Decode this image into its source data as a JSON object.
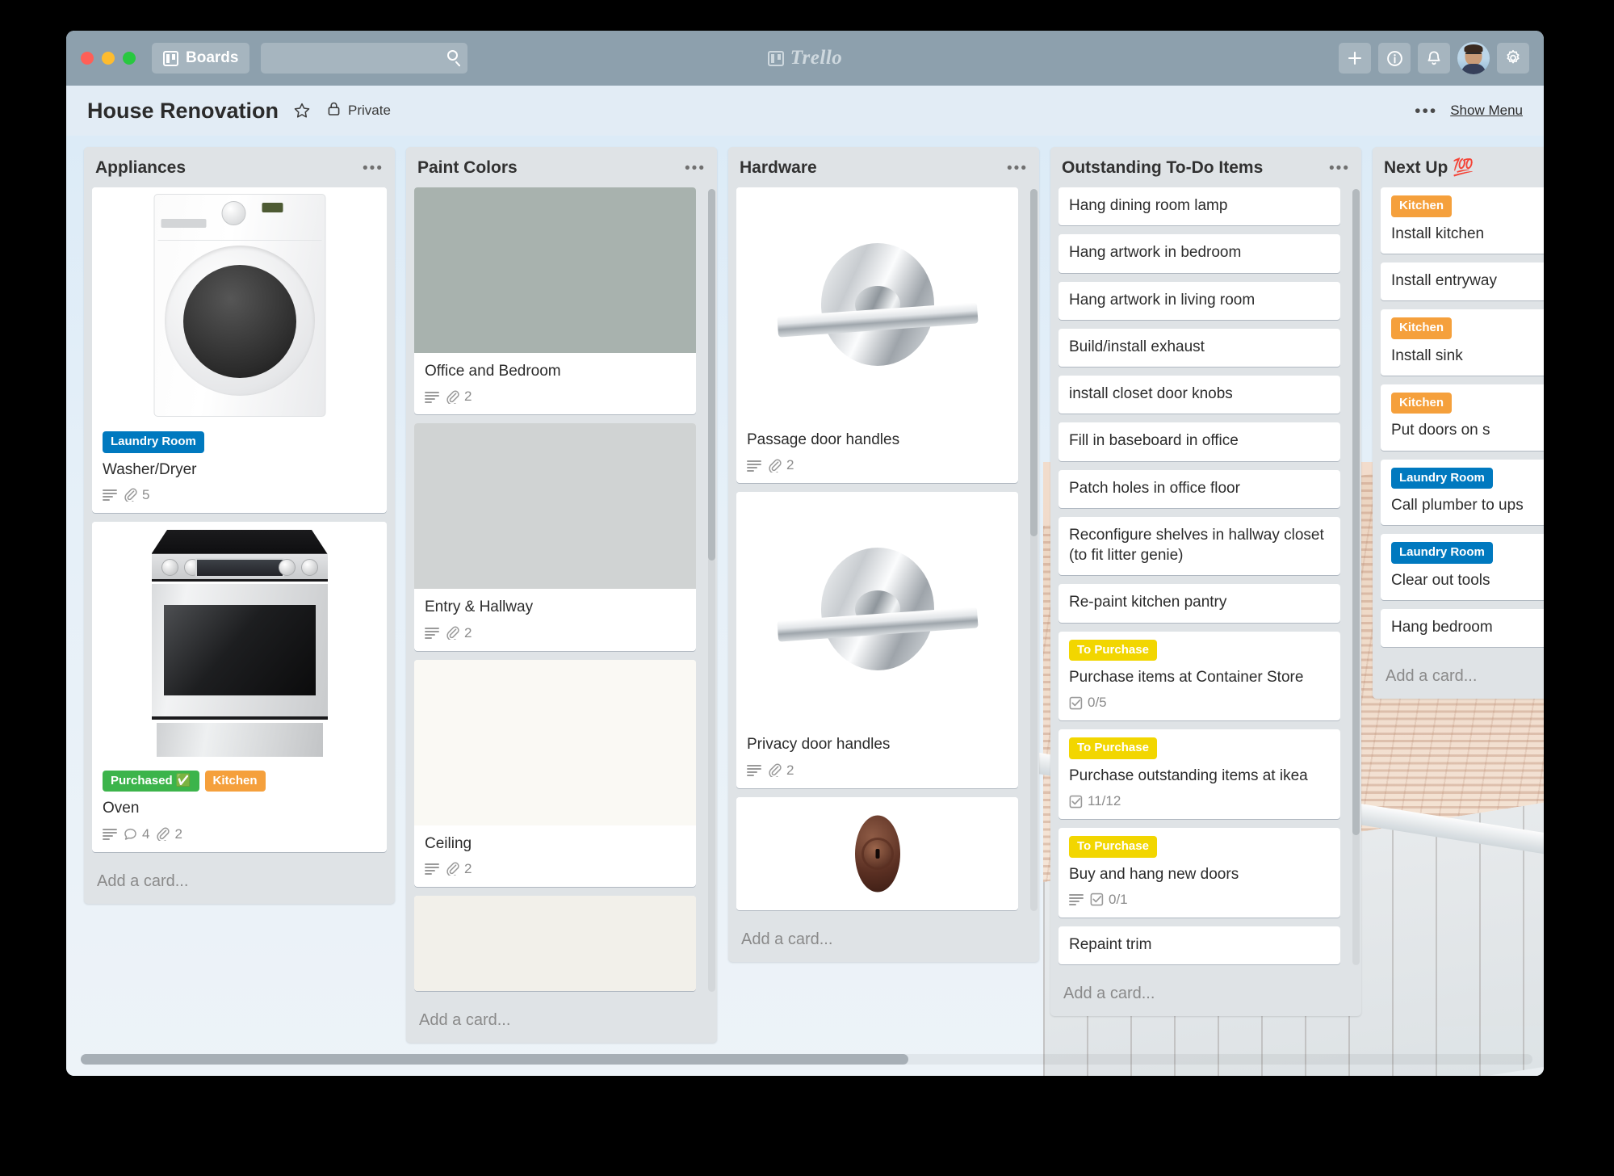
{
  "window": {
    "traffic_lights": [
      "close",
      "minimize",
      "zoom"
    ]
  },
  "topbar": {
    "boards_label": "Boards",
    "search_value": "",
    "search_placeholder": "",
    "brand": "Trello",
    "actions": [
      {
        "name": "add-button",
        "glyph": "plus"
      },
      {
        "name": "info-button",
        "glyph": "info"
      },
      {
        "name": "notifications-button",
        "glyph": "bell"
      },
      {
        "name": "settings-button",
        "glyph": "gear"
      }
    ]
  },
  "board_header": {
    "title": "House Renovation",
    "star_icon": "star-icon",
    "privacy_icon": "lock-icon",
    "privacy_label": "Private",
    "menu_dots": "•••",
    "show_menu_label": "Show Menu"
  },
  "lists": [
    {
      "title": "Appliances",
      "menu": "•••",
      "add_card": "Add a card...",
      "scroll": null,
      "cards": [
        {
          "cover": "washer-dryer-photo",
          "labels": [
            {
              "text": "Laundry Room",
              "color": "#0079bf"
            }
          ],
          "title": "Washer/Dryer",
          "badges": [
            {
              "icon": "description-icon",
              "value": ""
            },
            {
              "icon": "attachment-icon",
              "value": "5"
            }
          ]
        },
        {
          "cover": "oven-photo",
          "labels": [
            {
              "text": "Purchased ✅",
              "color": "#3cb44b"
            },
            {
              "text": "Kitchen",
              "color": "#f5a03c"
            }
          ],
          "title": "Oven",
          "badges": [
            {
              "icon": "description-icon",
              "value": ""
            },
            {
              "icon": "comment-icon",
              "value": "4"
            },
            {
              "icon": "attachment-icon",
              "value": "2"
            }
          ]
        }
      ]
    },
    {
      "title": "Paint Colors",
      "menu": "•••",
      "add_card": "Add a card...",
      "scroll": {
        "top_pct": 0,
        "height_pct": 56
      },
      "cards": [
        {
          "cover": "color-swatch",
          "swatch": "#a8b2ae",
          "labels": [],
          "title": "Office and Bedroom",
          "badges": [
            {
              "icon": "description-icon",
              "value": ""
            },
            {
              "icon": "attachment-icon",
              "value": "2"
            }
          ]
        },
        {
          "cover": "color-swatch",
          "swatch": "#d0d3d3",
          "labels": [],
          "title": "Entry & Hallway",
          "badges": [
            {
              "icon": "description-icon",
              "value": ""
            },
            {
              "icon": "attachment-icon",
              "value": "2"
            }
          ]
        },
        {
          "cover": "color-swatch",
          "swatch": "#faf9f4",
          "labels": [],
          "title": "Ceiling",
          "badges": [
            {
              "icon": "description-icon",
              "value": ""
            },
            {
              "icon": "attachment-icon",
              "value": "2"
            }
          ]
        },
        {
          "cover": "color-swatch",
          "swatch": "#f2f0ea",
          "labels": [],
          "title": "",
          "badges": []
        }
      ]
    },
    {
      "title": "Hardware",
      "menu": "•••",
      "add_card": "Add a card...",
      "scroll": {
        "top_pct": 0,
        "height_pct": 52
      },
      "cards": [
        {
          "cover": "lever-handle-photo",
          "labels": [],
          "title": "Passage door handles",
          "badges": [
            {
              "icon": "description-icon",
              "value": ""
            },
            {
              "icon": "attachment-icon",
              "value": "2"
            }
          ]
        },
        {
          "cover": "lever-handle-photo",
          "labels": [],
          "title": "Privacy door handles",
          "badges": [
            {
              "icon": "description-icon",
              "value": ""
            },
            {
              "icon": "attachment-icon",
              "value": "2"
            }
          ]
        },
        {
          "cover": "deadbolt-photo",
          "labels": [],
          "title": "",
          "badges": []
        }
      ]
    },
    {
      "title": "Outstanding To-Do Items",
      "menu": "•••",
      "add_card": "Add a card...",
      "scroll": {
        "top_pct": 0,
        "height_pct": 88
      },
      "cards": [
        {
          "cover": null,
          "labels": [],
          "title": "Hang dining room lamp",
          "badges": []
        },
        {
          "cover": null,
          "labels": [],
          "title": "Hang artwork in bedroom",
          "badges": []
        },
        {
          "cover": null,
          "labels": [],
          "title": "Hang artwork in living room",
          "badges": []
        },
        {
          "cover": null,
          "labels": [],
          "title": "Build/install exhaust",
          "badges": []
        },
        {
          "cover": null,
          "labels": [],
          "title": "install closet door knobs",
          "badges": []
        },
        {
          "cover": null,
          "labels": [],
          "title": "Fill in baseboard in office",
          "badges": []
        },
        {
          "cover": null,
          "labels": [],
          "title": "Patch holes in office floor",
          "badges": []
        },
        {
          "cover": null,
          "labels": [],
          "title": "Reconfigure shelves in hallway closet (to fit litter genie)",
          "badges": []
        },
        {
          "cover": null,
          "labels": [],
          "title": "Re-paint kitchen pantry",
          "badges": []
        },
        {
          "cover": null,
          "labels": [
            {
              "text": "To Purchase",
              "color": "#f2d600"
            }
          ],
          "title": "Purchase items at Container Store",
          "badges": [
            {
              "icon": "checklist-icon",
              "value": "0/5"
            }
          ]
        },
        {
          "cover": null,
          "labels": [
            {
              "text": "To Purchase",
              "color": "#f2d600"
            }
          ],
          "title": "Purchase outstanding items at ikea",
          "badges": [
            {
              "icon": "checklist-icon",
              "value": "11/12"
            }
          ]
        },
        {
          "cover": null,
          "labels": [
            {
              "text": "To Purchase",
              "color": "#f2d600"
            }
          ],
          "title": "Buy and hang new doors",
          "badges": [
            {
              "icon": "description-icon",
              "value": ""
            },
            {
              "icon": "checklist-icon",
              "value": "0/1"
            }
          ]
        },
        {
          "cover": null,
          "labels": [],
          "title": "Repaint trim",
          "badges": []
        }
      ]
    },
    {
      "title": "Next Up 💯",
      "menu": "•••",
      "add_card": "Add a card...",
      "scroll": null,
      "cards": [
        {
          "cover": null,
          "labels": [
            {
              "text": "Kitchen",
              "color": "#f5a03c"
            }
          ],
          "title": "Install kitchen",
          "badges": []
        },
        {
          "cover": null,
          "labels": [],
          "title": "Install entryway",
          "badges": []
        },
        {
          "cover": null,
          "labels": [
            {
              "text": "Kitchen",
              "color": "#f5a03c"
            }
          ],
          "title": "Install sink",
          "badges": []
        },
        {
          "cover": null,
          "labels": [
            {
              "text": "Kitchen",
              "color": "#f5a03c"
            }
          ],
          "title": "Put doors on s",
          "badges": []
        },
        {
          "cover": null,
          "labels": [
            {
              "text": "Laundry Room",
              "color": "#0079bf"
            }
          ],
          "title": "Call plumber to ups",
          "badges": []
        },
        {
          "cover": null,
          "labels": [
            {
              "text": "Laundry Room",
              "color": "#0079bf"
            }
          ],
          "title": "Clear out tools",
          "badges": []
        },
        {
          "cover": null,
          "labels": [],
          "title": "Hang bedroom",
          "badges": []
        }
      ]
    }
  ],
  "board_scrollbar": {
    "thumb_left_pct": 0,
    "thumb_width_pct": 57
  }
}
